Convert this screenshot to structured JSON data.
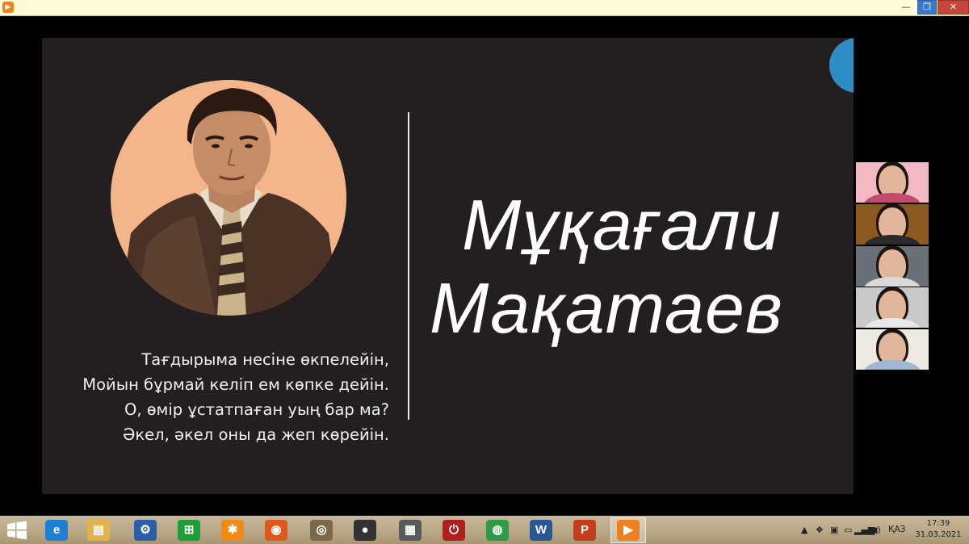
{
  "window": {
    "minimize_glyph": "—",
    "maximize_glyph": "❐",
    "close_glyph": "✕"
  },
  "slide": {
    "title_line1": "Мұқағали",
    "title_line2": "Мақатаев",
    "poem": [
      "Тағдырыма несіне өкпелейін,",
      "Мойын бұрмай келіп ем көпке дейін.",
      "О, өмір ұстатпаған уың бар ма?",
      "Әкел, әкел оны да жеп көрейін."
    ],
    "portrait_icon": "portrait-photo",
    "accent_color": "#2f8dc6",
    "portrait_bg": "#f5b58a",
    "background": "#231f20"
  },
  "participants": [
    {
      "bg": "#f2b8c4",
      "shirt": "#c24a6e"
    },
    {
      "bg": "#8a5a20",
      "shirt": "#2a2a2a"
    },
    {
      "bg": "#6a7078",
      "shirt": "#d9d9d9"
    },
    {
      "bg": "#c9c9cc",
      "shirt": "#e8e8ea"
    },
    {
      "bg": "#efe9e4",
      "shirt": "#9fb7cf"
    }
  ],
  "taskbar": {
    "apps": [
      {
        "name": "internet-explorer-icon",
        "glyph": "e",
        "color": "#1e7fd6"
      },
      {
        "name": "file-explorer-icon",
        "glyph": "▤",
        "color": "#e3b24a"
      },
      {
        "name": "control-panel-icon",
        "glyph": "⚙",
        "color": "#2b5ea8"
      },
      {
        "name": "store-icon",
        "glyph": "⊞",
        "color": "#1f9d3a"
      },
      {
        "name": "settings-gear-icon",
        "glyph": "✱",
        "color": "#f08a14"
      },
      {
        "name": "firefox-icon",
        "glyph": "◉",
        "color": "#e0581c"
      },
      {
        "name": "media-app-icon",
        "glyph": "◎",
        "color": "#7a6a4a"
      },
      {
        "name": "speaker-app-icon",
        "glyph": "●",
        "color": "#333333"
      },
      {
        "name": "utility-app-icon",
        "glyph": "▦",
        "color": "#5a5a5a"
      },
      {
        "name": "power-app-icon",
        "glyph": "⏻",
        "color": "#b21f1f"
      },
      {
        "name": "chrome-icon",
        "glyph": "◍",
        "color": "#2c9a47"
      },
      {
        "name": "word-icon",
        "glyph": "W",
        "color": "#2b5797"
      },
      {
        "name": "powerpoint-icon",
        "glyph": "P",
        "color": "#c43e1c"
      },
      {
        "name": "video-player-icon",
        "glyph": "▶",
        "color": "#f07f1f"
      }
    ],
    "language": "ҚАЗ",
    "time": "17:39",
    "date": "31.03.2021"
  }
}
